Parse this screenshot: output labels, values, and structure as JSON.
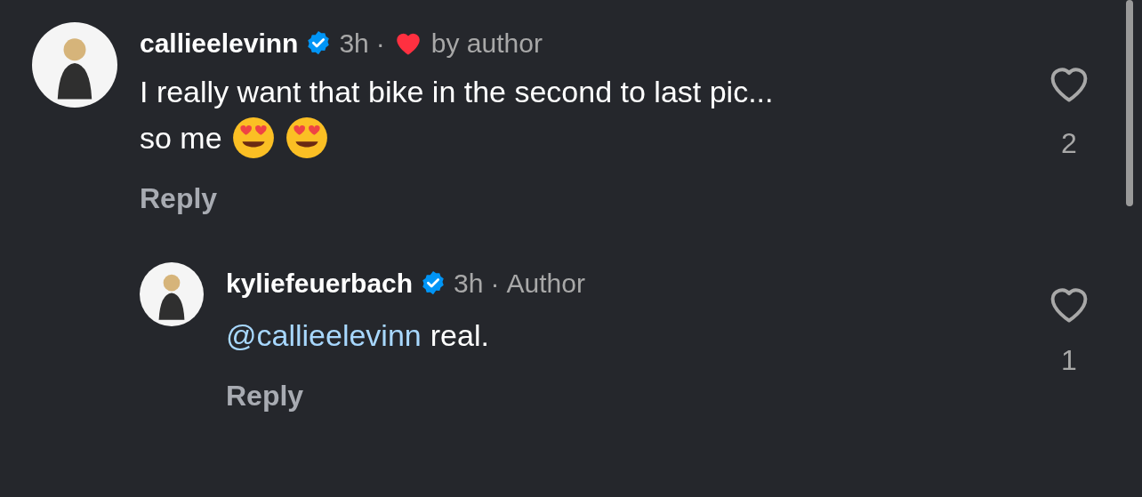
{
  "comments": [
    {
      "username": "callieelevinn",
      "verified": true,
      "time": "3h",
      "separator": "·",
      "liked_by_author": true,
      "liked_label": "by author",
      "lines": [
        "I really want that bike in the second to last pic...",
        "so me"
      ],
      "emojis": true,
      "reply_label": "Reply",
      "like_count": "2",
      "liked": false,
      "replies": [
        {
          "username": "kyliefeuerbach",
          "verified": true,
          "time": "3h",
          "separator": "·",
          "author_label": "Author",
          "mention": "@callieelevinn",
          "text": "real.",
          "reply_label": "Reply",
          "like_count": "1",
          "liked": false
        }
      ]
    }
  ]
}
